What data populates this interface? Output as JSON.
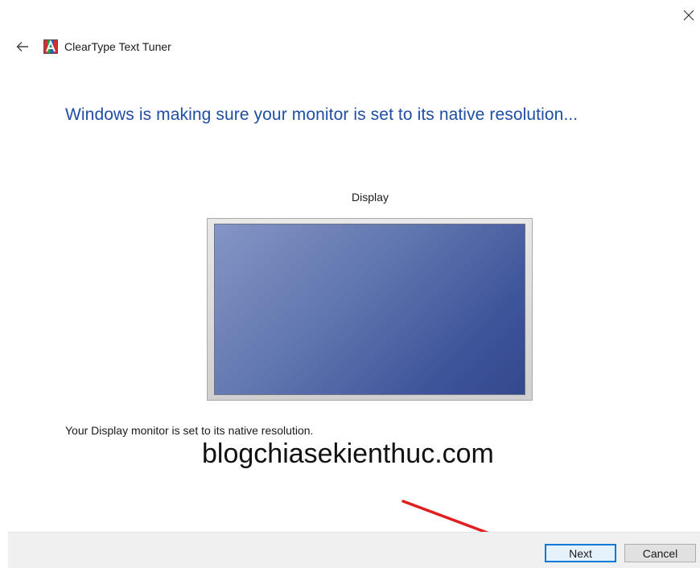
{
  "window": {
    "app_title": "ClearType Text Tuner",
    "back_icon": "back-arrow-icon",
    "app_icon": "cleartype-app-icon",
    "close_icon": "close-icon"
  },
  "main": {
    "heading": "Windows is making sure your monitor is set to its native resolution...",
    "display_label": "Display",
    "status_text": "Your Display monitor is set to its native resolution.",
    "watermark": "blogchiasekienthuc.com"
  },
  "footer": {
    "next_label": "Next",
    "cancel_label": "Cancel"
  },
  "colors": {
    "heading": "#1f4ea3",
    "annotation_arrow": "#e02020",
    "primary_button_border": "#0078d7"
  }
}
